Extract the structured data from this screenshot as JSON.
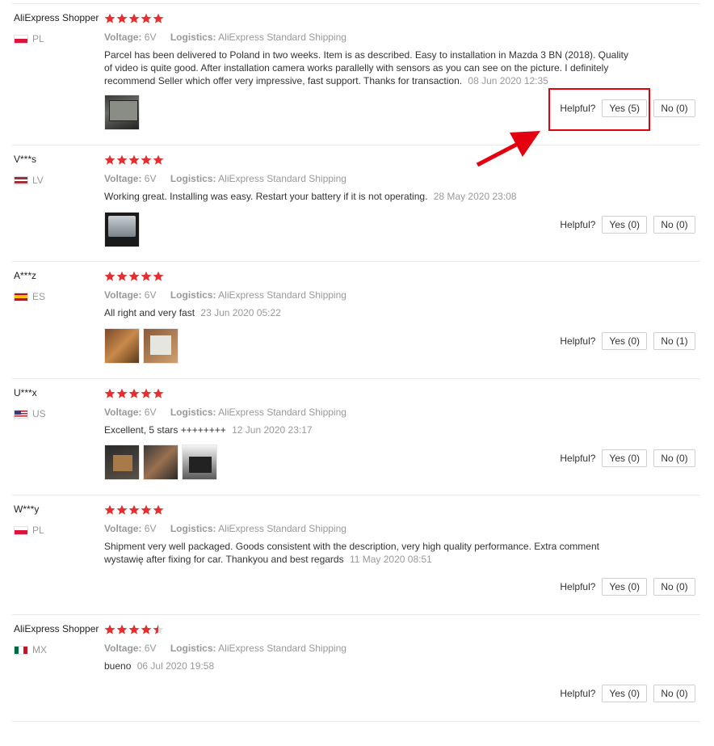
{
  "labels": {
    "voltage": "Voltage:",
    "logistics": "Logistics:",
    "helpful": "Helpful?"
  },
  "colors": {
    "star": "#e62e2e",
    "highlight": "#e3000f"
  },
  "reviews": [
    {
      "user": "AliExpress Shopper",
      "country": "PL",
      "flag": "pl",
      "stars": 5,
      "voltage": "6V",
      "logistics": "AliExpress Standard Shipping",
      "text": "Parcel has been delivered to Poland in two weeks. Item is as described. Easy to installation in Mazda 3 BN (2018). Quality of video is quite good. After installation camera works parallelly with sensors as you can see on the picture. I definitely recommend Seller which offer very impressive, fast support. Thanks for transaction.",
      "date": "08 Jun 2020 12:35",
      "photos": 1,
      "yes": "Yes (5)",
      "no": "No (0)"
    },
    {
      "user": "V***s",
      "country": "LV",
      "flag": "lv",
      "stars": 5,
      "voltage": "6V",
      "logistics": "AliExpress Standard Shipping",
      "text": "Working great. Installing was easy. Restart your battery if it is not operating.",
      "date": "28 May 2020 23:08",
      "photos": 1,
      "yes": "Yes (0)",
      "no": "No (0)"
    },
    {
      "user": "A***z",
      "country": "ES",
      "flag": "es",
      "stars": 5,
      "voltage": "6V",
      "logistics": "AliExpress Standard Shipping",
      "text": "All right and very fast",
      "date": "23 Jun 2020 05:22",
      "photos": 2,
      "yes": "Yes (0)",
      "no": "No (1)"
    },
    {
      "user": "U***x",
      "country": "US",
      "flag": "us",
      "stars": 5,
      "voltage": "6V",
      "logistics": "AliExpress Standard Shipping",
      "text": "Excellent, 5 stars ++++++++",
      "date": "12 Jun 2020 23:17",
      "photos": 3,
      "yes": "Yes (0)",
      "no": "No (0)"
    },
    {
      "user": "W***y",
      "country": "PL",
      "flag": "pl",
      "stars": 5,
      "voltage": "6V",
      "logistics": "AliExpress Standard Shipping",
      "text": "Shipment very well packaged. Goods consistent with the description, very high quality performance. Extra comment wystawię after fixing for car. Thankyou and best regards",
      "date": "11 May 2020 08:51",
      "photos": 0,
      "yes": "Yes (0)",
      "no": "No (0)"
    },
    {
      "user": "AliExpress Shopper",
      "country": "MX",
      "flag": "mx",
      "stars": 4.5,
      "voltage": "6V",
      "logistics": "AliExpress Standard Shipping",
      "text": "bueno",
      "date": "06 Jul 2020 19:58",
      "photos": 0,
      "yes": "Yes (0)",
      "no": "No (0)"
    }
  ]
}
